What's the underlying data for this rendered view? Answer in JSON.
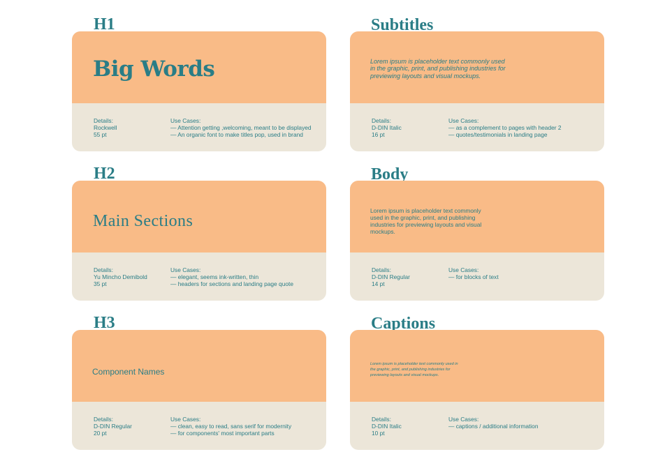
{
  "cards": [
    {
      "heading": "H1",
      "sample": "Big Words",
      "details_label": "Details:",
      "font": "Rockwell",
      "size": "55 pt",
      "use_cases_label": "Use Cases:",
      "use_cases": [
        "— Attention getting ,welcoming, meant to be displayed",
        "— An organic font to make titles pop, used in brand"
      ]
    },
    {
      "heading": "Subtitles",
      "sample": "Lorem ipsum is placeholder text commonly used in the graphic, print, and publishing industries for previewing layouts and visual mockups.",
      "details_label": "Details:",
      "font": "D-DIN Italic",
      "size": "16 pt",
      "use_cases_label": "Use Cases:",
      "use_cases": [
        "— as a complement to pages with header 2",
        "— quotes/testimonials in landing page"
      ]
    },
    {
      "heading": "H2",
      "sample": "Main Sections",
      "details_label": "Details:",
      "font": "Yu Mincho Demibold",
      "size": "35 pt",
      "use_cases_label": "Use Cases:",
      "use_cases": [
        "— elegant, seems ink-written, thin",
        "— headers for sections and landing page quote"
      ]
    },
    {
      "heading": "Body",
      "sample": "Lorem ipsum is placeholder text commonly used in the graphic, print, and publishing industries for previewing layouts and visual mockups.",
      "details_label": "Details:",
      "font": "D-DIN Regular",
      "size": "14 pt",
      "use_cases_label": "Use Cases:",
      "use_cases": [
        "— for blocks of text"
      ]
    },
    {
      "heading": "H3",
      "sample": "Component Names",
      "details_label": "Details:",
      "font": "D-DIN Regular",
      "size": "20 pt",
      "use_cases_label": "Use Cases:",
      "use_cases": [
        "— clean, easy to read, sans serif for modernity",
        "— for components' most important parts"
      ]
    },
    {
      "heading": "Captions",
      "sample": "Lorem ipsum is placeholder text commonly used in the graphic, print, and publishing industries for previewing layouts and visual mockups.",
      "details_label": "Details:",
      "font": "D-DIN Italic",
      "size": "10 pt",
      "use_cases_label": "Use Cases:",
      "use_cases": [
        "— captions / additional information"
      ]
    }
  ],
  "colors": {
    "accent_teal": "#2a7d86",
    "sample_panel": "#f9bb87",
    "details_panel": "#ece6d9",
    "background": "#ffffff"
  }
}
